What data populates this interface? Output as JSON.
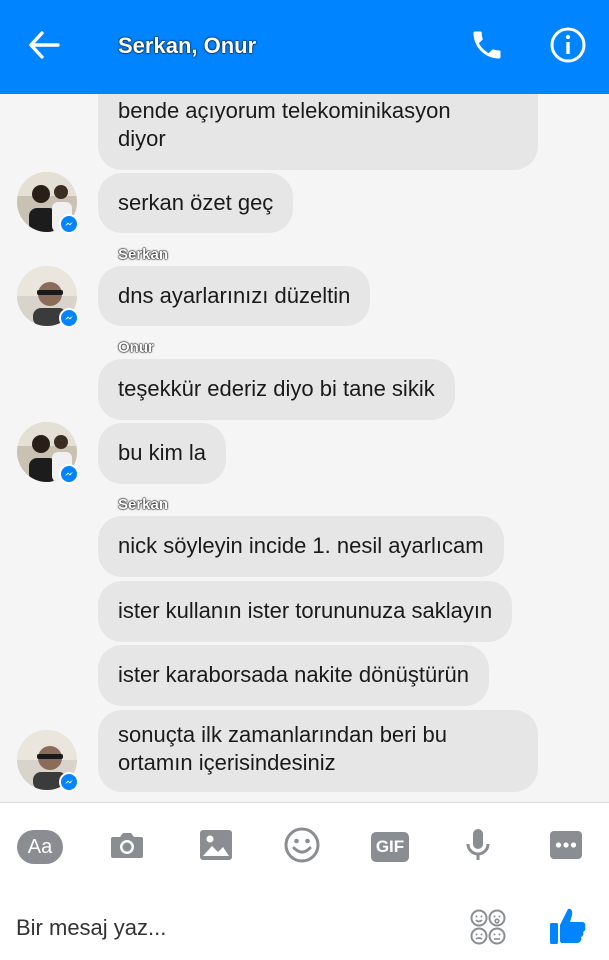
{
  "header": {
    "title": "Serkan, Onur",
    "back_icon": "arrow-left-icon",
    "call_icon": "phone-icon",
    "info_icon": "info-icon",
    "bg_color": "#0084ff"
  },
  "messages": [
    {
      "lines": [
        "bende açıyorum telekominikasyon",
        "diyor"
      ]
    },
    {
      "lines": [
        "serkan özet geç"
      ]
    },
    {
      "sender": "Serkan"
    },
    {
      "lines": [
        "dns ayarlarınızı düzeltin"
      ]
    },
    {
      "sender": "Onur"
    },
    {
      "lines": [
        "teşekkür ederiz diyo bi tane sikik"
      ]
    },
    {
      "lines": [
        "bu kim la"
      ]
    },
    {
      "sender": "Serkan"
    },
    {
      "lines": [
        "nick söyleyin incide 1. nesil ayarlıcam"
      ]
    },
    {
      "lines": [
        "ister kullanın ister torununuza saklayın"
      ]
    },
    {
      "lines": [
        "ister karaborsada nakite dönüştürün"
      ]
    },
    {
      "lines": [
        "sonuçta ilk zamanlarından beri bu",
        "ortamın içerisindesiniz"
      ]
    }
  ],
  "toolbar": {
    "aa_label": "Aa",
    "gif_label": "GIF",
    "icons": [
      "text-format-icon",
      "camera-icon",
      "image-icon",
      "emoji-icon",
      "gif-icon",
      "microphone-icon",
      "more-icon"
    ]
  },
  "composer": {
    "placeholder": "Bir mesaj yaz...",
    "emoji_icon": "emoji-pad-icon",
    "like_icon": "thumbs-up-icon"
  },
  "colors": {
    "accent": "#0084ff",
    "bubble": "#e6e6e6",
    "background": "#f5f5f5",
    "icon_gray": "#8a8d91"
  }
}
